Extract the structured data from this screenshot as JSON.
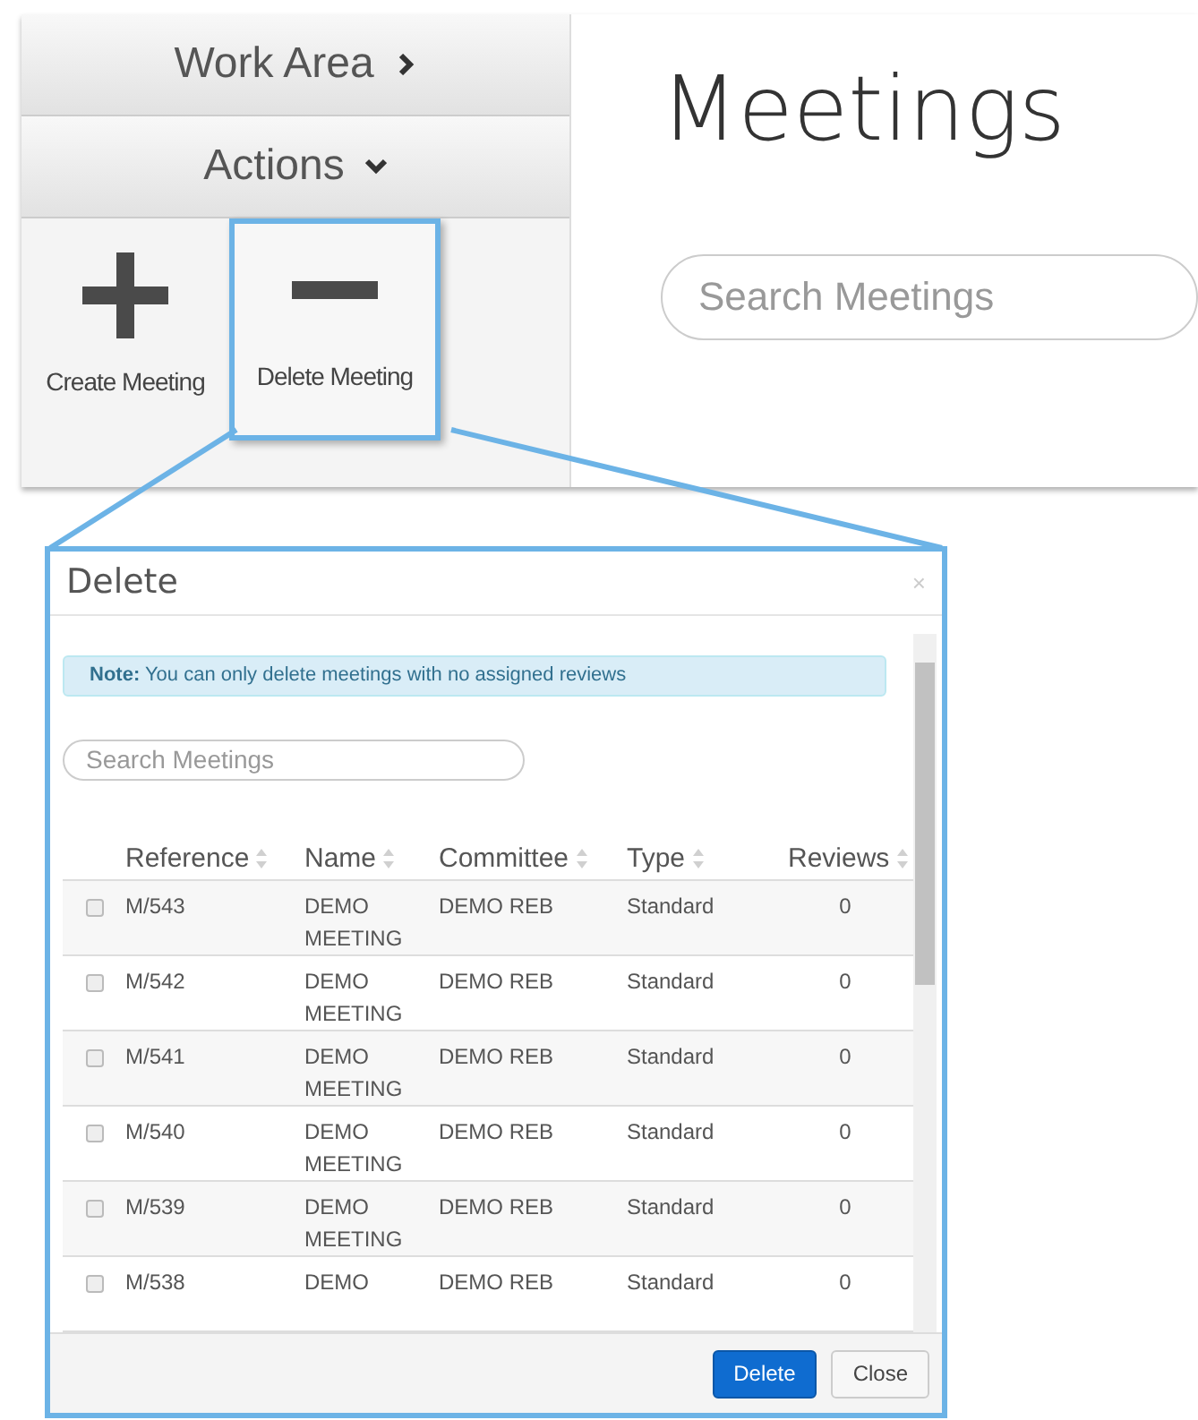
{
  "sidebar": {
    "sections": [
      {
        "label": "Work Area",
        "expanded": false
      },
      {
        "label": "Actions",
        "expanded": true
      }
    ],
    "actions": [
      {
        "label": "Create Meeting",
        "kind": "create",
        "highlighted": false
      },
      {
        "label": "Delete Meeting",
        "kind": "delete",
        "highlighted": true
      }
    ]
  },
  "main": {
    "title": "Meetings",
    "search": {
      "placeholder": "Search Meetings"
    }
  },
  "dialog": {
    "title": "Delete",
    "close": "×",
    "note": {
      "label": "Note:",
      "text": "You can only delete meetings with no assigned reviews"
    },
    "search": {
      "placeholder": "Search Meetings"
    },
    "table": {
      "columns": [
        "Reference",
        "Name",
        "Committee",
        "Type",
        "Reviews"
      ],
      "rows": [
        {
          "checked": false,
          "cells": [
            "M/543",
            "DEMO MEETING",
            "DEMO REB",
            "Standard",
            "0"
          ]
        },
        {
          "checked": false,
          "cells": [
            "M/542",
            "DEMO MEETING",
            "DEMO REB",
            "Standard",
            "0"
          ]
        },
        {
          "checked": false,
          "cells": [
            "M/541",
            "DEMO MEETING",
            "DEMO REB",
            "Standard",
            "0"
          ]
        },
        {
          "checked": false,
          "cells": [
            "M/540",
            "DEMO MEETING",
            "DEMO REB",
            "Standard",
            "0"
          ]
        },
        {
          "checked": false,
          "cells": [
            "M/539",
            "DEMO MEETING",
            "DEMO REB",
            "Standard",
            "0"
          ]
        },
        {
          "checked": false,
          "cells": [
            "M/538",
            "DEMO",
            "DEMO REB",
            "Standard",
            "0"
          ]
        }
      ]
    },
    "buttons": [
      {
        "label": "Delete",
        "kind": "primary"
      },
      {
        "label": "Close",
        "kind": "default"
      }
    ]
  }
}
